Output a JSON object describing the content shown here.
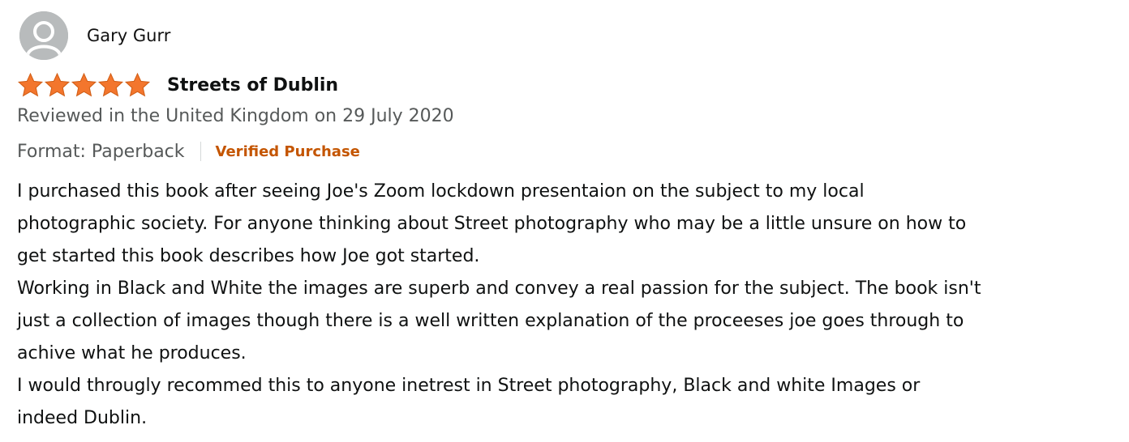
{
  "reviewer": {
    "name": "Gary Gurr",
    "avatar_icon": "default-user-avatar-icon"
  },
  "rating": {
    "stars": 5,
    "max": 5,
    "icon": "star-icon",
    "color": "#f3762d"
  },
  "review": {
    "title": "Streets of Dublin",
    "date_line": "Reviewed in the United Kingdom on 29 July 2020",
    "format": "Format: Paperback",
    "verified": "Verified Purchase",
    "body_lines": [
      "I purchased this book after seeing Joe's Zoom lockdown presentaion on the subject to my local",
      "photographic society. For anyone thinking about Street photography who may be a little unsure on how to",
      "get started this book describes how Joe got started.",
      "Working in Black and White the images are superb and convey a real passion for the subject. The book isn't",
      "just a collection of images though there is a well written explanation of the proceeses joe goes through to",
      "achive what he produces.",
      "I would througly recommed this to anyone inetrest in Street photography, Black and white Images or",
      "indeed Dublin."
    ]
  },
  "colors": {
    "verified": "#c45500",
    "meta_text": "#565959",
    "avatar_bg": "#b8bbbc"
  }
}
